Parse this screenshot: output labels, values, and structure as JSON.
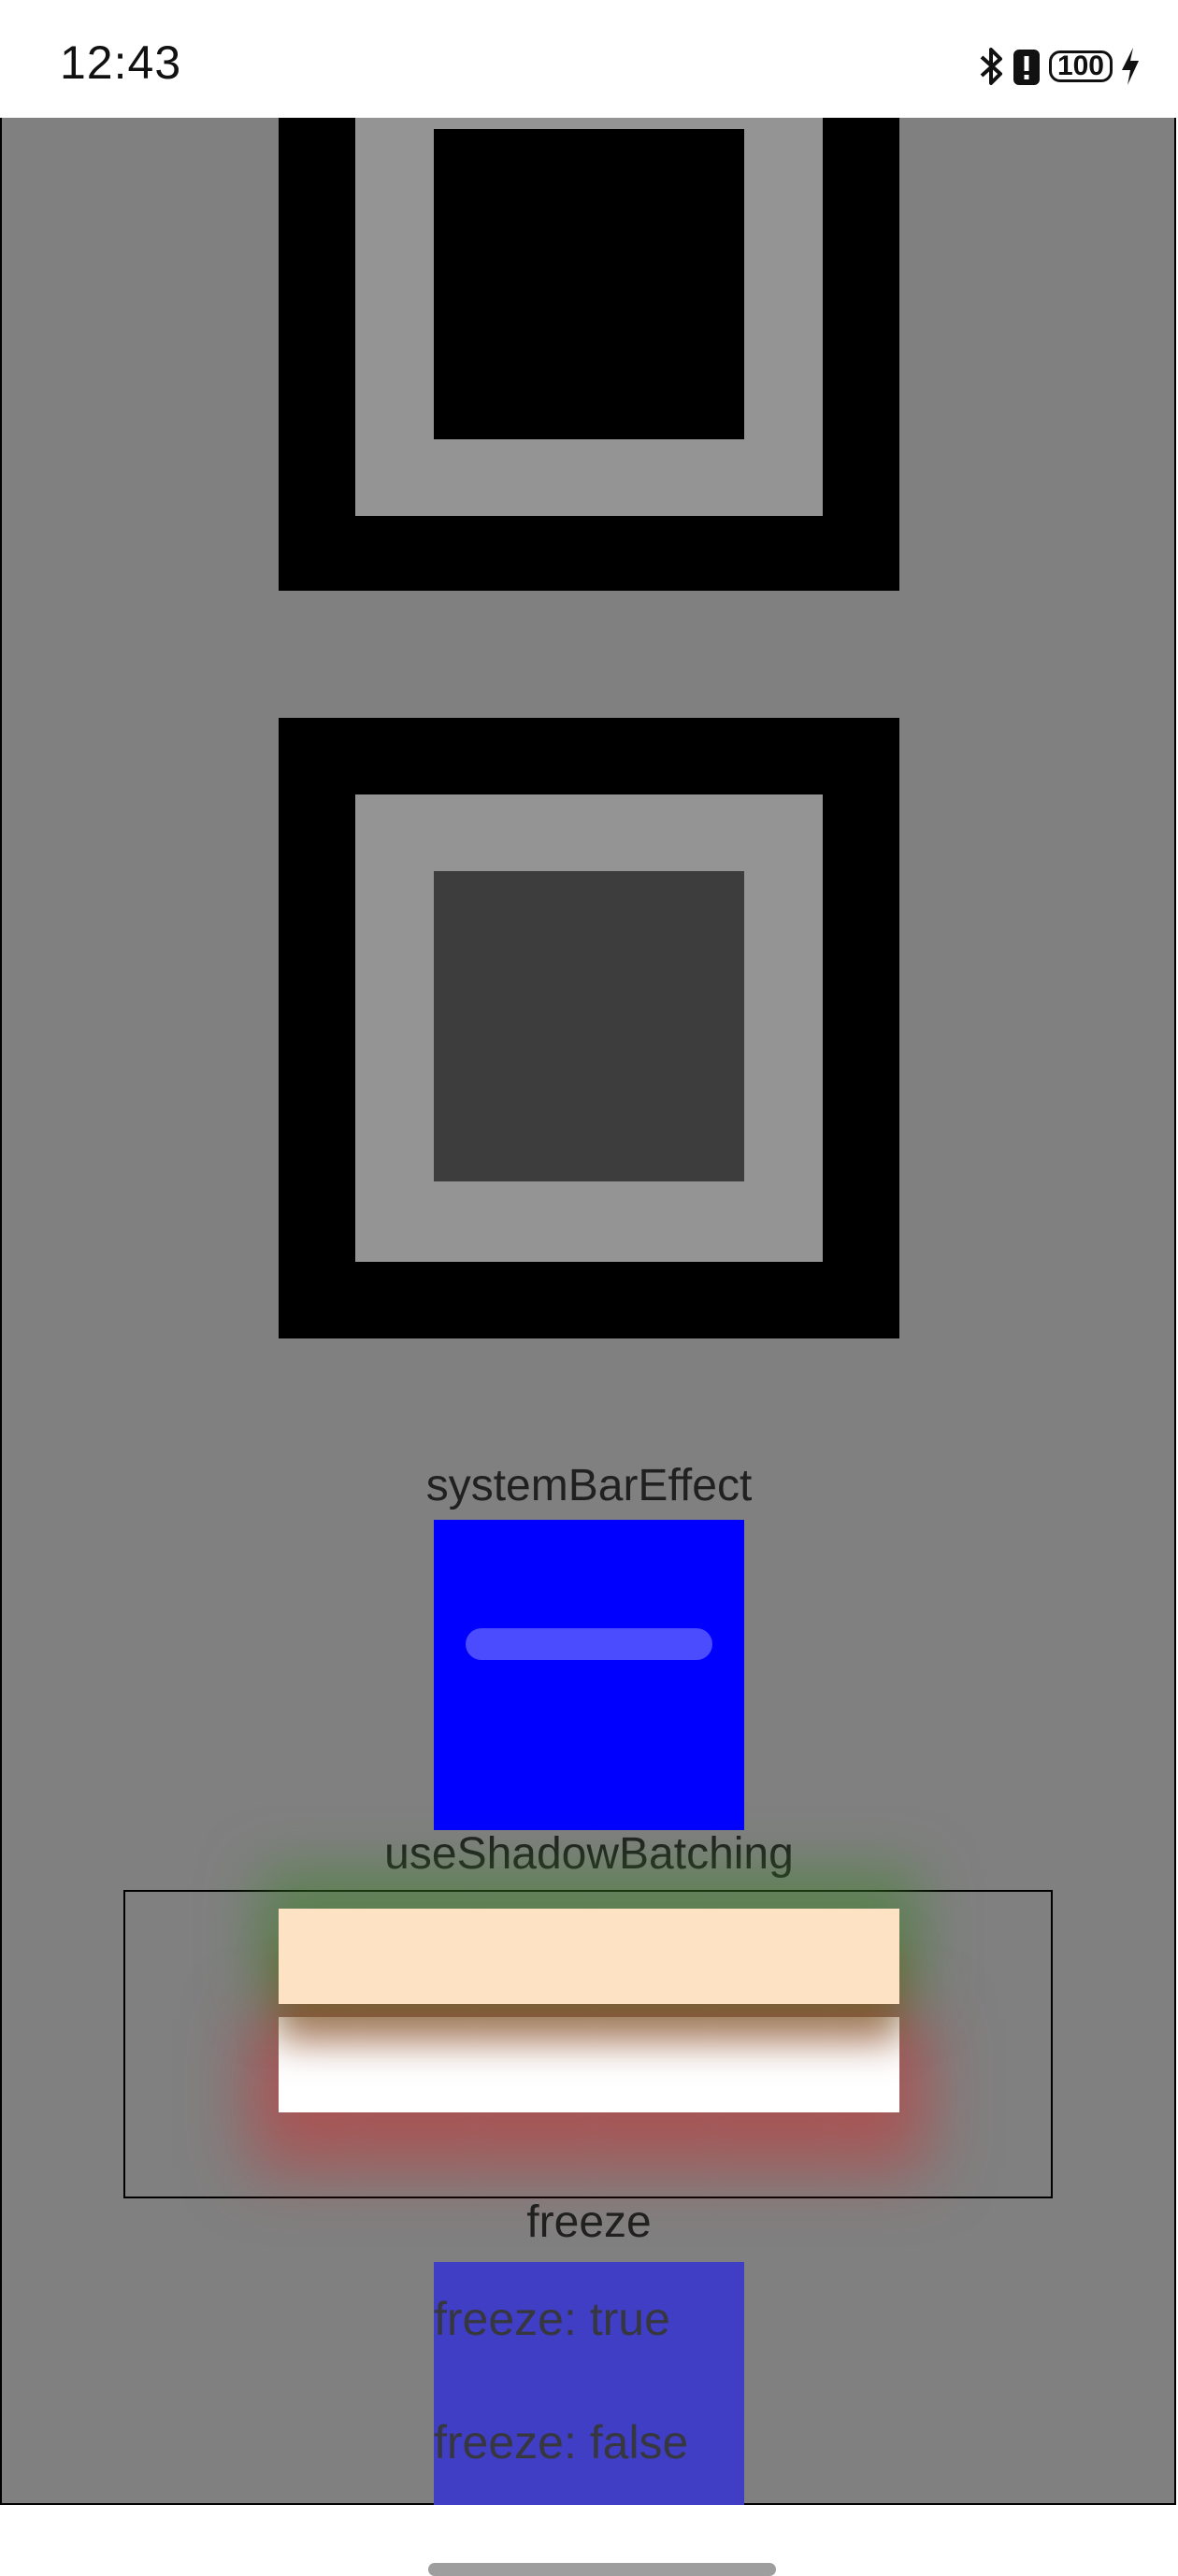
{
  "status_bar": {
    "time": "12:43",
    "battery": "100",
    "icons": [
      "bluetooth-icon",
      "battery-alert-icon",
      "battery-icon",
      "charging-icon"
    ]
  },
  "labels": {
    "system_bar_effect": "systemBarEffect",
    "use_shadow_batching": "useShadowBatching",
    "freeze": "freeze"
  },
  "freeze_items": {
    "true_label": "freeze: true",
    "false_label": "freeze: false"
  },
  "colors": {
    "page_bg": "#808080",
    "square_outer": "#000000",
    "square_mid": "#949494",
    "square_top_inner": "#000000",
    "square_bottom_inner": "#3d3d3d",
    "system_bar_box": "#0000ff",
    "shadow_bar_top": "#fde3c3",
    "shadow_bar_bottom": "#ffffff",
    "freeze_box": "#3f3ec4"
  }
}
